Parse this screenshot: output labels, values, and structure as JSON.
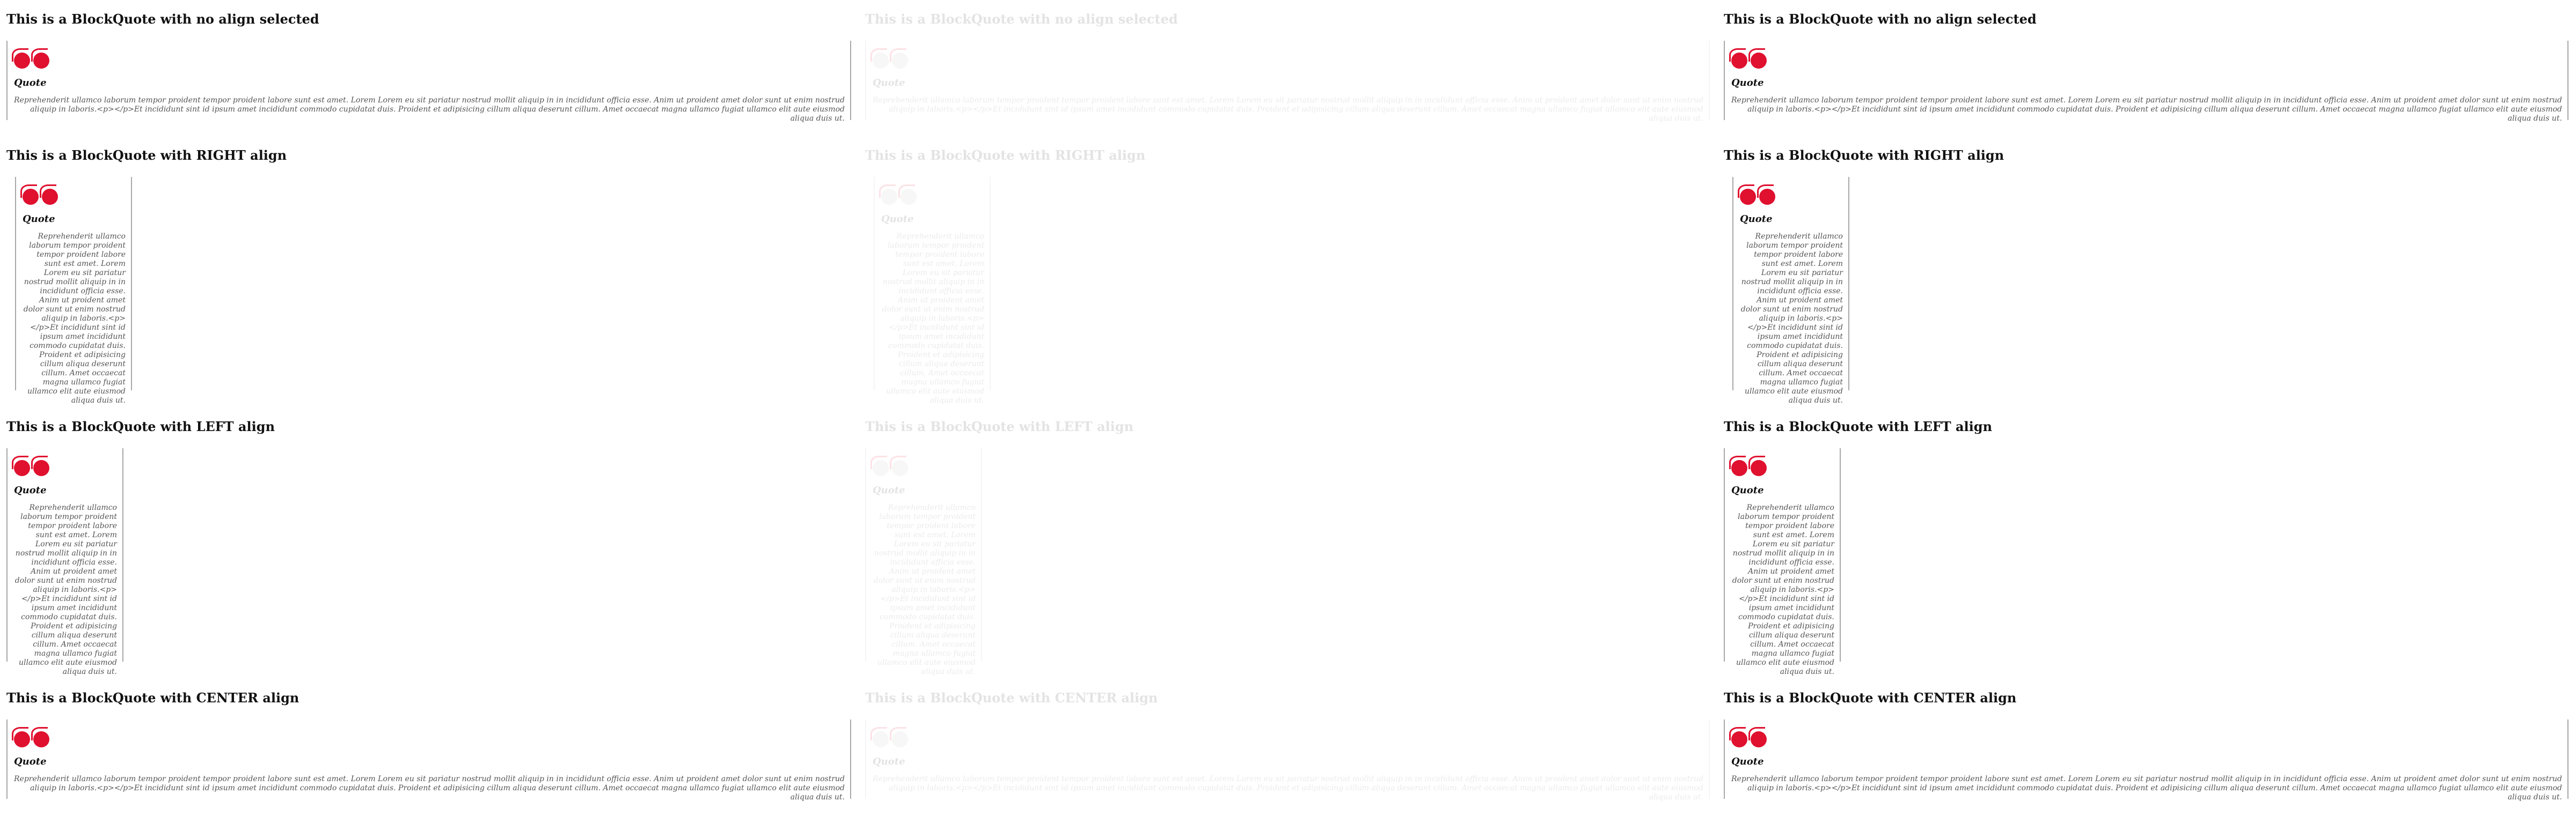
{
  "headings": {
    "none": "This is a BlockQuote with no align selected",
    "right": "This is a BlockQuote with RIGHT align",
    "left": "This is a BlockQuote with LEFT align",
    "center": "This is a BlockQuote with CENTER align"
  },
  "quote_label": "Quote",
  "quote_text": "Reprehenderit ullamco laborum tempor proident tempor proident labore sunt est amet. Lorem Lorem eu sit pariatur nostrud mollit aliquip in in incididunt officia esse. Anim ut proident amet dolor sunt ut enim nostrud aliquip in laboris.<p></p>Et incididunt sint id ipsum amet incididunt commodo cupidatat duis. Proident et adipisicing cillum aliqua deserunt cillum. Amet occaecat magna ullamco fugiat ullamco elit aute eiusmod aliqua duis ut.",
  "colors": {
    "quote_mark": "#e0102f",
    "border": "#a8a8a8"
  }
}
